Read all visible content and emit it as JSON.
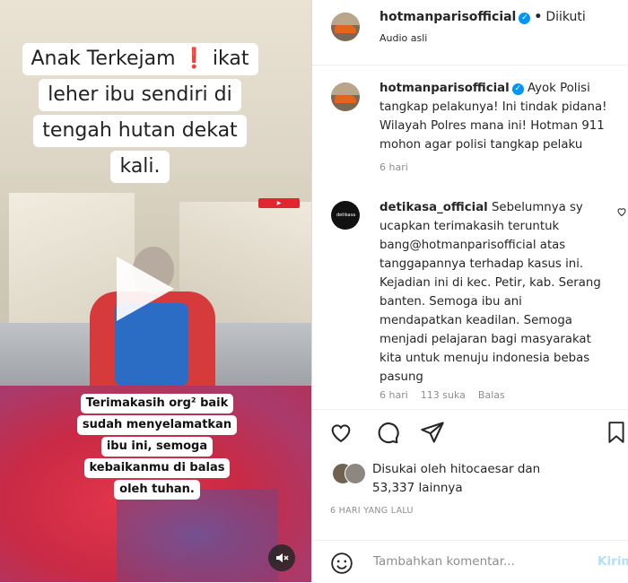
{
  "media": {
    "caption_top_lines": [
      "Anak Terkejam",
      "ikat",
      "leher ibu sendiri di",
      "tengah hutan dekat",
      "kali."
    ],
    "caption_top_emoji": "❗",
    "caption_bottom_lines": [
      "Terimakasih org² baik",
      "sudah menyelamatkan",
      "ibu ini, semoga",
      "kebaikanmu di balas",
      "oleh tuhan."
    ],
    "mute_icon": "speaker-muted-icon"
  },
  "header": {
    "username": "hotmanparisofficial",
    "verified": true,
    "follow_status": "Diikuti",
    "subtitle": "Audio asli"
  },
  "caption_comment": {
    "username": "hotmanparisofficial",
    "verified": true,
    "text_lines": [
      "Ayok Polisi",
      "tangkap pelakunya! Ini tindak pidana!",
      "Wilayah Polres mana ini! Hotman 911",
      "mohon agar polisi tangkap pelaku"
    ],
    "time": "6 hari"
  },
  "comment": {
    "username": "detikasa_official",
    "avatar_label": "detikasa",
    "text_lines": [
      "Sebelumnya sy",
      "ucapkan terimakasih teruntuk",
      "bang@hotmanparisofficial atas",
      "tanggapannya terhadap kasus ini.",
      "Kejadian ini di kec. Petir, kab. Serang",
      "banten. Semoga ibu ani",
      "mendapatkan keadilan. Semoga",
      "menjadi pelajaran bagi masyarakat",
      "kita untuk menuju indonesia bebas",
      "pasung"
    ],
    "time": "6 hari",
    "likes": "113 suka",
    "reply_label": "Balas"
  },
  "likes": {
    "prefix": "Disukai oleh",
    "user": "hitocaesar",
    "mid": "dan",
    "count": "53,337",
    "suffix": "lainnya"
  },
  "time_ago": "6 HARI YANG LALU",
  "add_comment": {
    "placeholder": "Tambahkan komentar...",
    "post_label": "Kirim"
  },
  "colors": {
    "accent": "#0095f6",
    "post_disabled": "#b2dffc",
    "muted": "#8e8e8e"
  }
}
